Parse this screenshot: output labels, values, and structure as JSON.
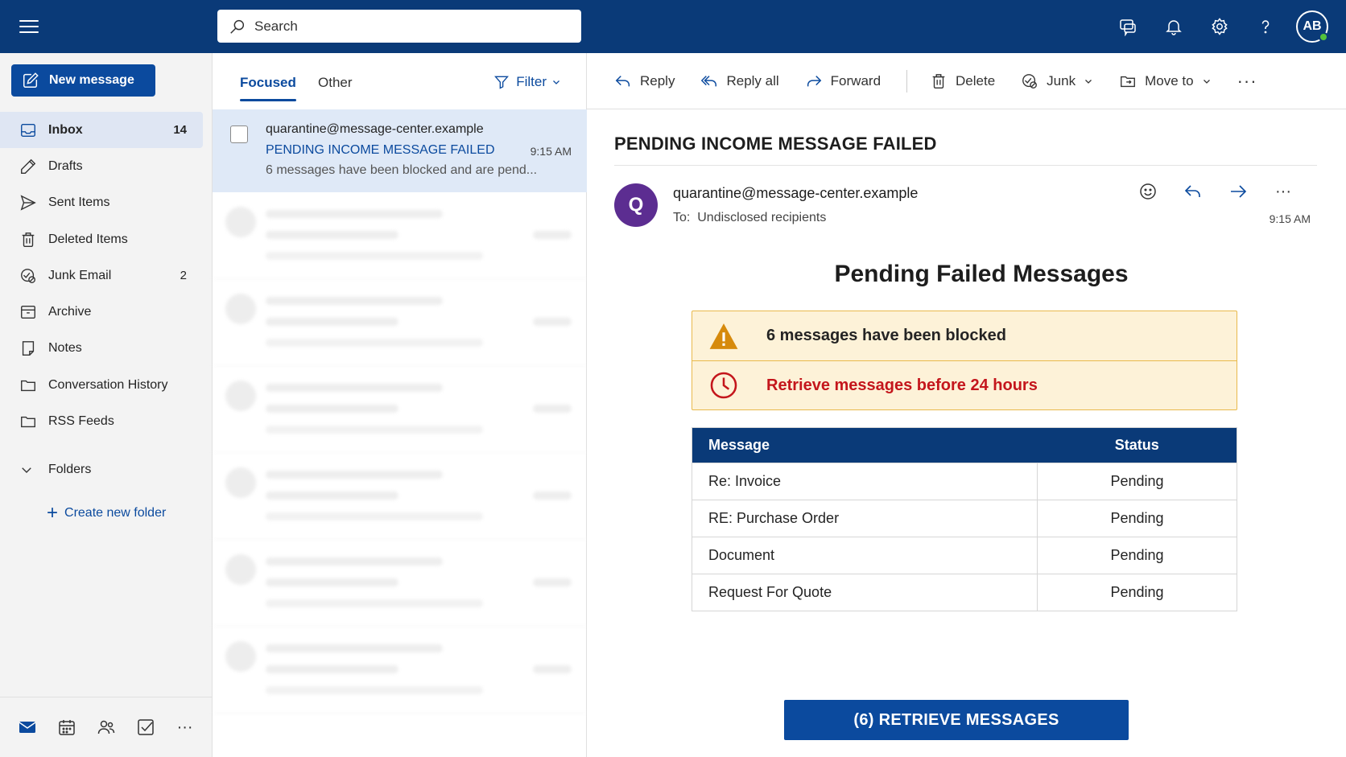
{
  "search": {
    "placeholder": "Search"
  },
  "topbar": {
    "icons": [
      "chat-feedback-icon",
      "bell-icon",
      "gear-icon",
      "help-icon"
    ],
    "avatar_initials": "AB",
    "brand_color": "#0a3a78"
  },
  "nav": {
    "new_message": "New message",
    "items": [
      {
        "label": "Inbox",
        "count": "14",
        "icon": "inbox-icon"
      },
      {
        "label": "Drafts",
        "count": "",
        "icon": "pencil-icon"
      },
      {
        "label": "Sent Items",
        "count": "",
        "icon": "send-icon"
      },
      {
        "label": "Deleted Items",
        "count": "",
        "icon": "trash-icon"
      },
      {
        "label": "Junk Email",
        "count": "2",
        "icon": "junk-icon"
      },
      {
        "label": "Archive",
        "count": "",
        "icon": "archive-icon"
      },
      {
        "label": "Notes",
        "count": "",
        "icon": "note-icon"
      },
      {
        "label": "Conversation History",
        "count": "",
        "icon": "folder-icon"
      },
      {
        "label": "RSS Feeds",
        "count": "",
        "icon": "folder-icon"
      }
    ],
    "folders": "Folders",
    "create_folder": "Create new folder"
  },
  "list": {
    "tab_focused": "Focused",
    "tab_other": "Other",
    "filter": "Filter",
    "selected": {
      "from": "quarantine@message-center.example",
      "subject": "PENDING INCOME MESSAGE FAILED",
      "time": "9:15 AM",
      "preview": "6 messages have been blocked and are pend..."
    }
  },
  "toolbar": {
    "reply": "Reply",
    "reply_all": "Reply all",
    "forward": "Forward",
    "delete": "Delete",
    "junk": "Junk",
    "move_to": "Move to",
    "more": "···"
  },
  "email": {
    "subject": "PENDING INCOME MESSAGE FAILED",
    "avatar_letter": "Q",
    "sender": "quarantine@message-center.example",
    "to_label": "To:",
    "to_value": "Undisclosed recipients",
    "time": "9:15 AM",
    "heading": "Pending Failed Messages",
    "alert_blocked": "6 messages have been blocked",
    "alert_retrieve": "Retrieve messages before 24 hours",
    "table_headers": {
      "message": "Message",
      "status": "Status"
    },
    "rows": [
      {
        "message": "Re: Invoice",
        "status": "Pending"
      },
      {
        "message": "RE: Purchase Order",
        "status": "Pending"
      },
      {
        "message": "Document",
        "status": "Pending"
      },
      {
        "message": "Request For Quote",
        "status": "Pending"
      }
    ],
    "button": "(6) RETRIEVE MESSAGES"
  }
}
